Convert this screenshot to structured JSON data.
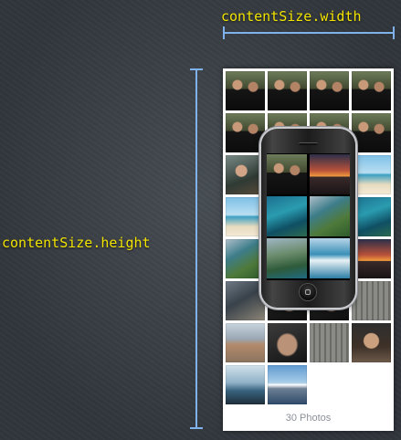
{
  "labels": {
    "width": "contentSize.width",
    "height": "contentSize.height"
  },
  "footer": {
    "photo_count": "30 Photos"
  },
  "colors": {
    "label_text": "#f2e400",
    "dimension_line": "#7fb2ea",
    "background": "#3b4249"
  },
  "thumbnails": [
    {
      "kind": "graduation"
    },
    {
      "kind": "graduation"
    },
    {
      "kind": "graduation"
    },
    {
      "kind": "graduation"
    },
    {
      "kind": "graduation"
    },
    {
      "kind": "graduation"
    },
    {
      "kind": "graduation"
    },
    {
      "kind": "graduation"
    },
    {
      "kind": "people"
    },
    {
      "kind": "people"
    },
    {
      "kind": "sunset"
    },
    {
      "kind": "beach"
    },
    {
      "kind": "beach"
    },
    {
      "kind": "ocean"
    },
    {
      "kind": "coast"
    },
    {
      "kind": "ocean"
    },
    {
      "kind": "coast"
    },
    {
      "kind": "island"
    },
    {
      "kind": "wave"
    },
    {
      "kind": "sunset"
    },
    {
      "kind": "rock"
    },
    {
      "kind": "dark"
    },
    {
      "kind": "dark"
    },
    {
      "kind": "building"
    },
    {
      "kind": "city"
    },
    {
      "kind": "hand"
    },
    {
      "kind": "building"
    },
    {
      "kind": "portrait"
    },
    {
      "kind": "lake"
    },
    {
      "kind": "mountain"
    }
  ],
  "phone_screen_thumbnails": [
    {
      "kind": "graduation"
    },
    {
      "kind": "sunset"
    },
    {
      "kind": "ocean"
    },
    {
      "kind": "coast"
    },
    {
      "kind": "island"
    },
    {
      "kind": "wave"
    }
  ]
}
